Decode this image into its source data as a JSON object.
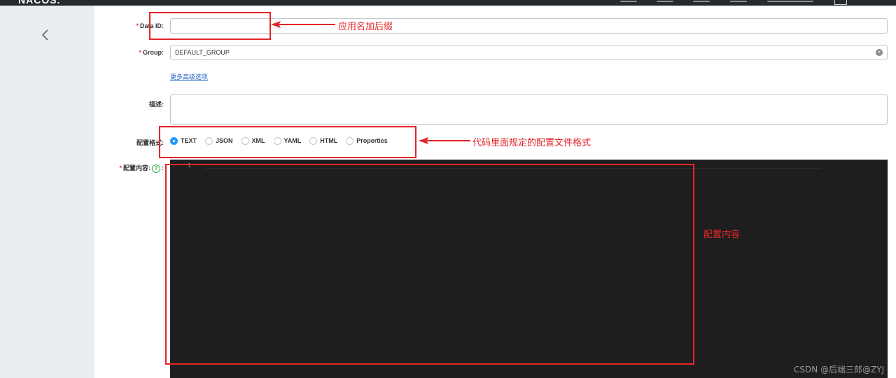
{
  "header": {
    "logo_text": "NACOS."
  },
  "form": {
    "data_id": {
      "label": "Data ID:",
      "value": ""
    },
    "group": {
      "label": "Group:",
      "value": "DEFAULT_GROUP"
    },
    "advanced_link": "更多高级选项",
    "description": {
      "label": "描述:",
      "value": ""
    },
    "format": {
      "label": "配置格式:",
      "options": [
        "TEXT",
        "JSON",
        "XML",
        "YAML",
        "HTML",
        "Properties"
      ],
      "selected": "TEXT"
    },
    "content": {
      "label": "配置内容:",
      "line_number": "1"
    }
  },
  "annotations": {
    "data_id_note": "应用名加后缀",
    "format_note": "代码里面规定的配置文件格式",
    "content_note": "配置内容",
    "color": "#e4252a"
  },
  "watermark": "CSDN @后端三郎@ZYJ"
}
